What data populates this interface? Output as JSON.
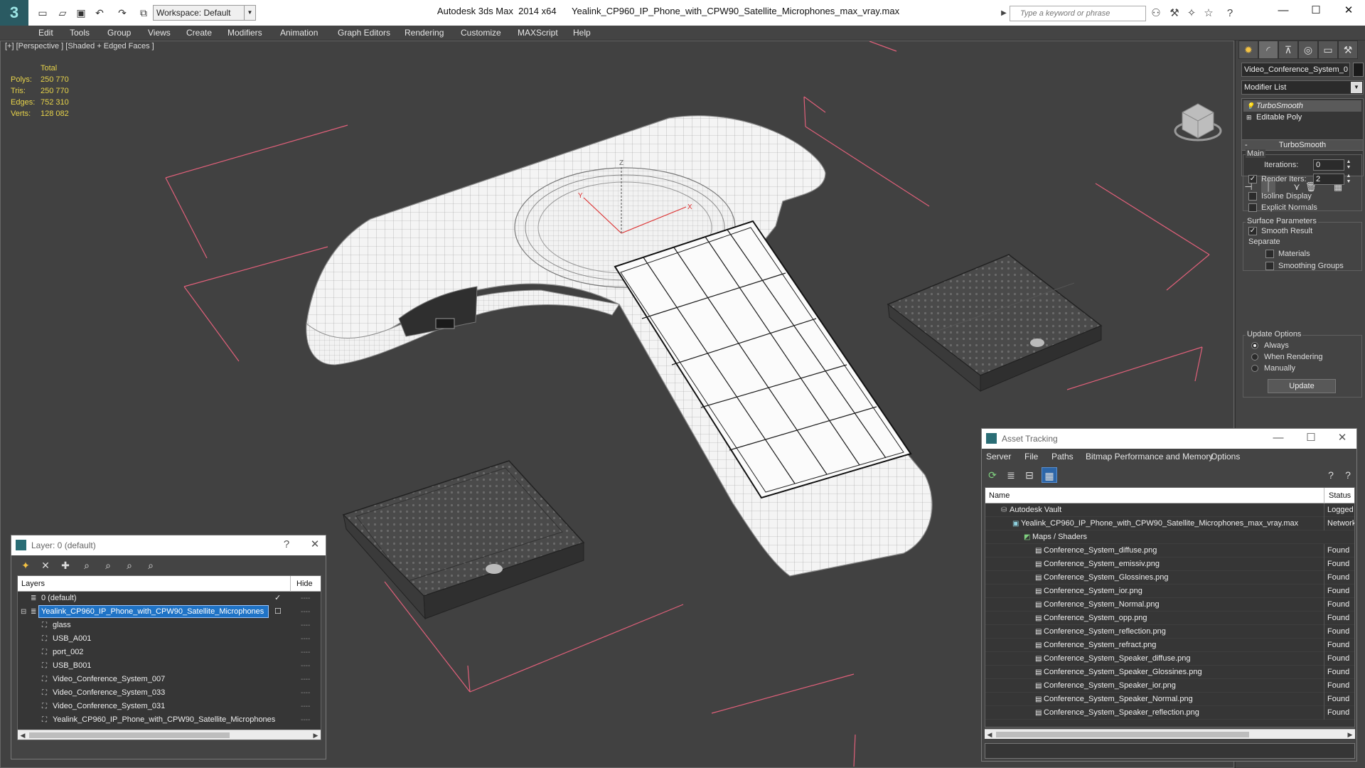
{
  "titlebar": {
    "workspace": "Workspace: Default",
    "app": "Autodesk 3ds Max  2014 x64",
    "file": "Yealink_CP960_IP_Phone_with_CPW90_Satellite_Microphones_max_vray.max",
    "search_placeholder": "Type a keyword or phrase"
  },
  "menu": [
    "Edit",
    "Tools",
    "Group",
    "Views",
    "Create",
    "Modifiers",
    "Animation",
    "Graph Editors",
    "Rendering",
    "Customize",
    "MAXScript",
    "Help"
  ],
  "viewport": {
    "label": "[+] [Perspective ] [Shaded + Edged Faces ]",
    "stats": {
      "header": "Total",
      "rows": [
        {
          "k": "Polys:",
          "v": "250 770"
        },
        {
          "k": "Tris:",
          "v": "250 770"
        },
        {
          "k": "Edges:",
          "v": "752 310"
        },
        {
          "k": "Verts:",
          "v": "128 082"
        }
      ]
    },
    "gizmo": {
      "x": "X",
      "y": "Y",
      "z": "Z"
    }
  },
  "command_panel": {
    "object_name": "Video_Conference_System_0",
    "modifier_list": "Modifier List",
    "stack": [
      "TurboSmooth",
      "Editable Poly"
    ],
    "rollout": "TurboSmooth",
    "main_label": "Main",
    "iterations_label": "Iterations:",
    "iterations": "0",
    "render_iters_label": "Render Iters:",
    "render_iters": "2",
    "isoline": "Isoline Display",
    "explicit_normals": "Explicit Normals",
    "surface_params": "Surface Parameters",
    "smooth_result": "Smooth Result",
    "separate": "Separate",
    "materials": "Materials",
    "smoothing_groups": "Smoothing Groups",
    "update_options": "Update Options",
    "always": "Always",
    "when_rendering": "When Rendering",
    "manually": "Manually",
    "update_button": "Update"
  },
  "layer_dialog": {
    "title": "Layer: 0 (default)",
    "help": "?",
    "col_layers": "Layers",
    "col_hide": "Hide",
    "rows": [
      {
        "name": "0 (default)",
        "indent": 0
      },
      {
        "name": "Yealink_CP960_IP_Phone_with_CPW90_Satellite_Microphones",
        "indent": 0
      },
      {
        "name": "glass",
        "indent": 1
      },
      {
        "name": "USB_A001",
        "indent": 1
      },
      {
        "name": "port_002",
        "indent": 1
      },
      {
        "name": "USB_B001",
        "indent": 1
      },
      {
        "name": "Video_Conference_System_007",
        "indent": 1
      },
      {
        "name": "Video_Conference_System_033",
        "indent": 1
      },
      {
        "name": "Video_Conference_System_031",
        "indent": 1
      },
      {
        "name": "Yealink_CP960_IP_Phone_with_CPW90_Satellite_Microphones",
        "indent": 1
      }
    ]
  },
  "asset_dialog": {
    "title": "Asset Tracking",
    "menu": [
      "Server",
      "File",
      "Paths",
      "Bitmap Performance and Memory",
      "Options"
    ],
    "col_name": "Name",
    "col_status": "Status",
    "rows": [
      {
        "name": "Autodesk Vault",
        "status": "Logged Out",
        "indent": 1
      },
      {
        "name": "Yealink_CP960_IP_Phone_with_CPW90_Satellite_Microphones_max_vray.max",
        "status": "Network",
        "indent": 2
      },
      {
        "name": "Maps / Shaders",
        "status": "",
        "indent": 3
      },
      {
        "name": "Conference_System_diffuse.png",
        "status": "Found",
        "indent": 4
      },
      {
        "name": "Conference_System_emissiv.png",
        "status": "Found",
        "indent": 4
      },
      {
        "name": "Conference_System_Glossines.png",
        "status": "Found",
        "indent": 4
      },
      {
        "name": "Conference_System_ior.png",
        "status": "Found",
        "indent": 4
      },
      {
        "name": "Conference_System_Normal.png",
        "status": "Found",
        "indent": 4
      },
      {
        "name": "Conference_System_opp.png",
        "status": "Found",
        "indent": 4
      },
      {
        "name": "Conference_System_reflection.png",
        "status": "Found",
        "indent": 4
      },
      {
        "name": "Conference_System_refract.png",
        "status": "Found",
        "indent": 4
      },
      {
        "name": "Conference_System_Speaker_diffuse.png",
        "status": "Found",
        "indent": 4
      },
      {
        "name": "Conference_System_Speaker_Glossines.png",
        "status": "Found",
        "indent": 4
      },
      {
        "name": "Conference_System_Speaker_ior.png",
        "status": "Found",
        "indent": 4
      },
      {
        "name": "Conference_System_Speaker_Normal.png",
        "status": "Found",
        "indent": 4
      },
      {
        "name": "Conference_System_Speaker_reflection.png",
        "status": "Found",
        "indent": 4
      }
    ]
  },
  "colors": {
    "selection": "#1f73c6",
    "stats": "#e7d34a",
    "bbox": "#e0607a"
  }
}
